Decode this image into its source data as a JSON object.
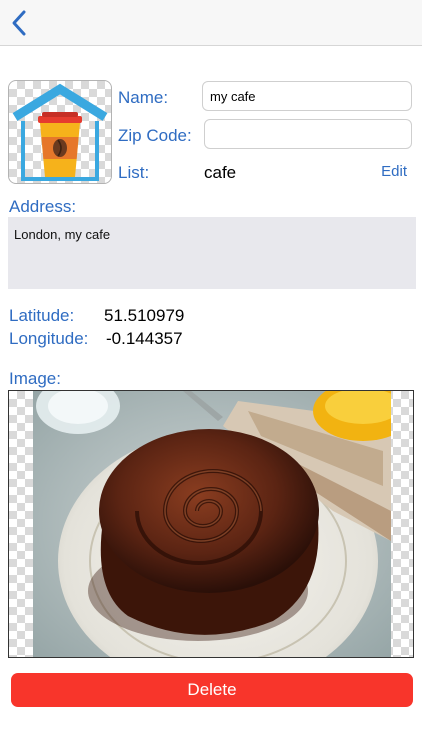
{
  "nav": {
    "back_icon": "chevron-left-icon",
    "accent": "#2f6cc2"
  },
  "thumbnail": {
    "icon": "coffee-cup-house-icon"
  },
  "form": {
    "name_label": "Name:",
    "name_value": "my cafe",
    "zip_label": "Zip Code:",
    "zip_value": "",
    "list_label": "List:",
    "list_value": "cafe",
    "edit_label": "Edit",
    "address_label": "Address:",
    "address_value": "London, my cafe",
    "latitude_label": "Latitude:",
    "latitude_value": "51.510979",
    "longitude_label": "Longitude:",
    "longitude_value": "-0.144357",
    "image_label": "Image:"
  },
  "photo": {
    "subject": "cake-photo"
  },
  "actions": {
    "delete_label": "Delete",
    "delete_color": "#f8352b"
  }
}
